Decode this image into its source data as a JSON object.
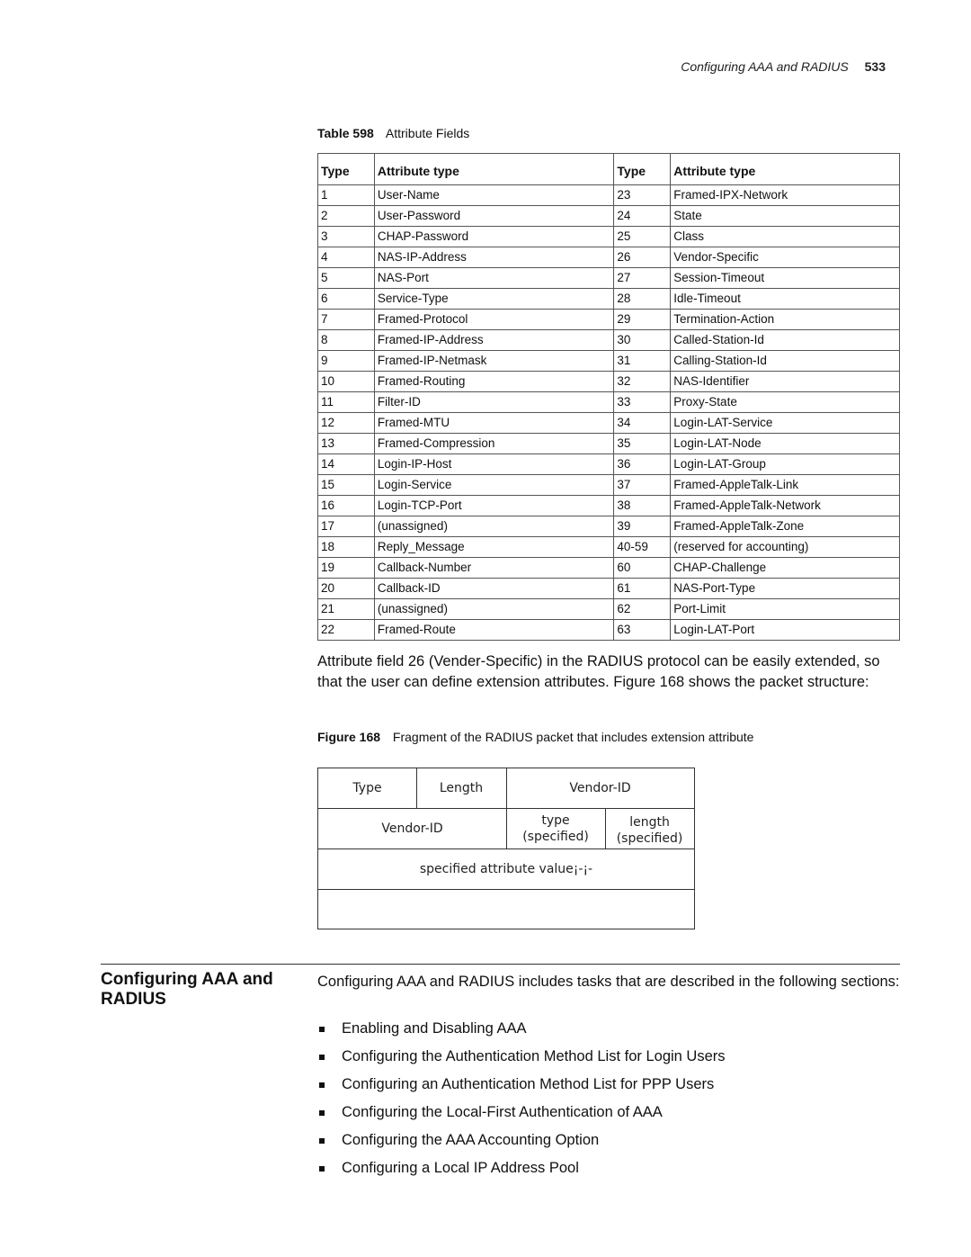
{
  "running_head": {
    "title": "Configuring AAA and RADIUS",
    "page": "533"
  },
  "table": {
    "caption_label": "Table 598",
    "caption_title": "Attribute Fields",
    "headers": [
      "Type",
      "Attribute type",
      "Type",
      "Attribute type"
    ],
    "rows": [
      [
        "1",
        "User-Name",
        "23",
        "Framed-IPX-Network"
      ],
      [
        "2",
        "User-Password",
        "24",
        "State"
      ],
      [
        "3",
        "CHAP-Password",
        "25",
        "Class"
      ],
      [
        "4",
        "NAS-IP-Address",
        "26",
        "Vendor-Specific"
      ],
      [
        "5",
        "NAS-Port",
        "27",
        "Session-Timeout"
      ],
      [
        "6",
        "Service-Type",
        "28",
        "Idle-Timeout"
      ],
      [
        "7",
        "Framed-Protocol",
        "29",
        "Termination-Action"
      ],
      [
        "8",
        "Framed-IP-Address",
        "30",
        "Called-Station-Id"
      ],
      [
        "9",
        "Framed-IP-Netmask",
        "31",
        "Calling-Station-Id"
      ],
      [
        "10",
        "Framed-Routing",
        "32",
        "NAS-Identifier"
      ],
      [
        "11",
        "Filter-ID",
        "33",
        "Proxy-State"
      ],
      [
        "12",
        "Framed-MTU",
        "34",
        "Login-LAT-Service"
      ],
      [
        "13",
        "Framed-Compression",
        "35",
        "Login-LAT-Node"
      ],
      [
        "14",
        "Login-IP-Host",
        "36",
        "Login-LAT-Group"
      ],
      [
        "15",
        "Login-Service",
        "37",
        "Framed-AppleTalk-Link"
      ],
      [
        "16",
        "Login-TCP-Port",
        "38",
        "Framed-AppleTalk-Network"
      ],
      [
        "17",
        "(unassigned)",
        "39",
        "Framed-AppleTalk-Zone"
      ],
      [
        "18",
        "Reply_Message",
        "40-59",
        "(reserved for accounting)"
      ],
      [
        "19",
        "Callback-Number",
        "60",
        "CHAP-Challenge"
      ],
      [
        "20",
        "Callback-ID",
        "61",
        "NAS-Port-Type"
      ],
      [
        "21",
        "(unassigned)",
        "62",
        "Port-Limit"
      ],
      [
        "22",
        "Framed-Route",
        "63",
        "Login-LAT-Port"
      ]
    ]
  },
  "paragraph": "Attribute field 26 (Vender-Specific) in the RADIUS protocol can be easily extended, so that the user can define extension attributes. Figure 168 shows the packet structure:",
  "figure": {
    "caption_label": "Figure 168",
    "caption_title": "Fragment of the RADIUS packet that includes extension attribute",
    "cells": {
      "type": "Type",
      "length": "Length",
      "vendor_id_top": "Vendor-ID",
      "vendor_id_bottom": "Vendor-ID",
      "type_specified_1": "type",
      "type_specified_2": "(specified)",
      "length_specified_1": "length",
      "length_specified_2": "(specified)",
      "attribute_value": "specified attribute value¡-¡-",
      "empty_row": ""
    }
  },
  "section": {
    "heading_line1": "Configuring AAA and",
    "heading_line2": "RADIUS",
    "intro": "Configuring AAA and RADIUS includes tasks that are described in the following sections:",
    "tasks": [
      "Enabling and Disabling AAA",
      "Configuring the Authentication Method List for Login Users",
      "Configuring an Authentication Method List for PPP Users",
      "Configuring the Local-First Authentication of AAA",
      "Configuring the AAA Accounting Option",
      "Configuring a Local IP Address Pool"
    ]
  }
}
